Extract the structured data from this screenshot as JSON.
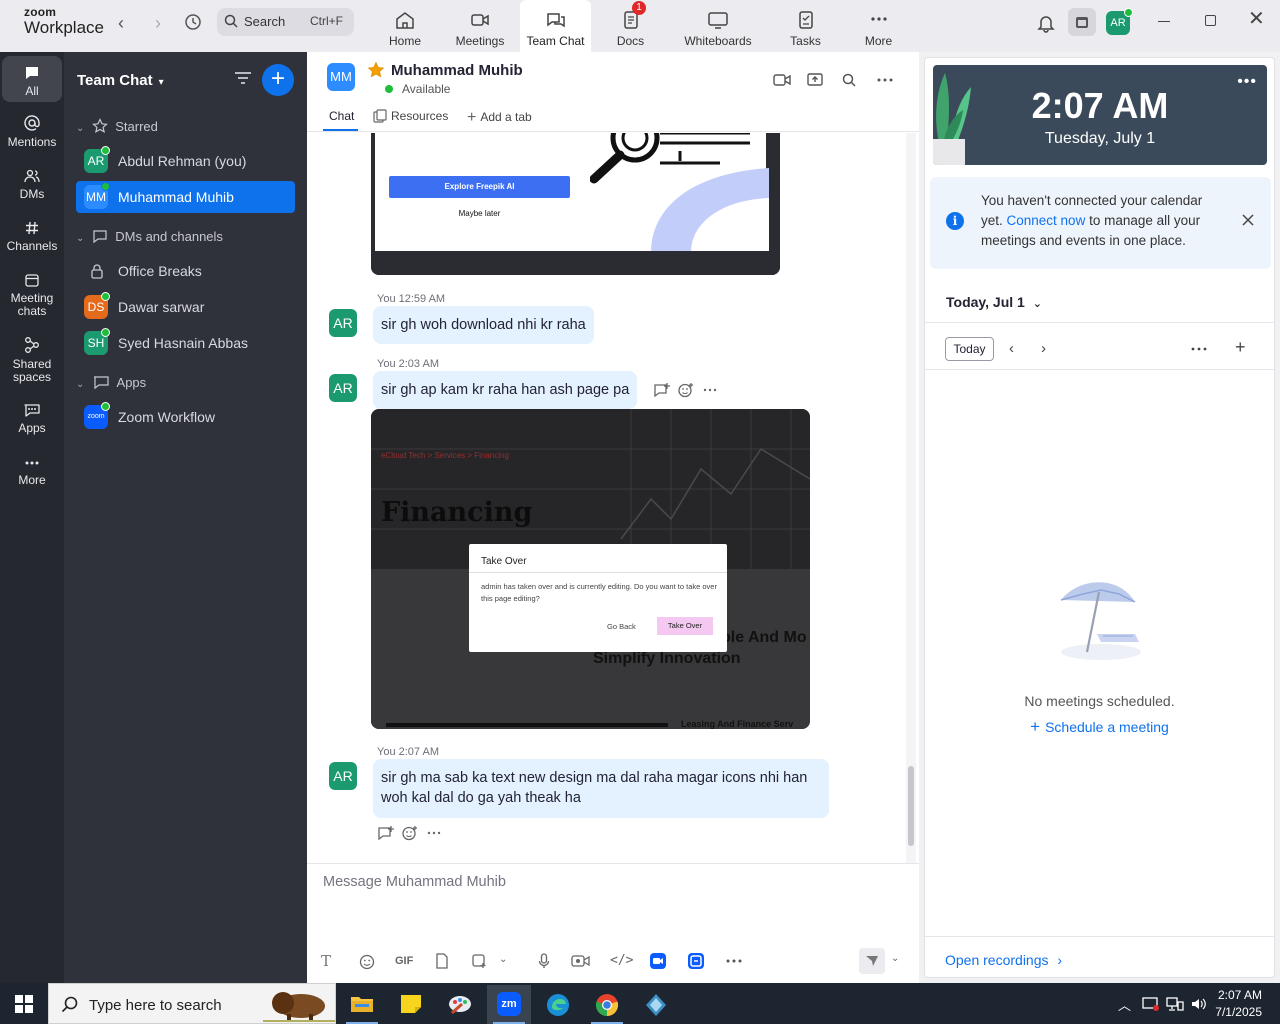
{
  "app": {
    "brand_line1": "zoom",
    "brand_line2": "Workplace"
  },
  "search": {
    "label": "Search",
    "shortcut": "Ctrl+F"
  },
  "top_tabs": [
    {
      "label": "Home",
      "icon": "home-icon"
    },
    {
      "label": "Meetings",
      "icon": "video-icon"
    },
    {
      "label": "Team Chat",
      "icon": "chat-icon",
      "active": true
    },
    {
      "label": "Docs",
      "icon": "docs-icon",
      "badge": "1"
    },
    {
      "label": "Whiteboards",
      "icon": "whiteboard-icon"
    },
    {
      "label": "Tasks",
      "icon": "tasks-icon"
    },
    {
      "label": "More",
      "icon": "more-dots-icon"
    }
  ],
  "user_avatar": "AR",
  "rail": [
    {
      "label": "All",
      "icon": "chat-bubble-icon",
      "active": true
    },
    {
      "label": "Mentions",
      "icon": "at-icon"
    },
    {
      "label": "DMs",
      "icon": "people-icon"
    },
    {
      "label": "Channels",
      "icon": "hash-icon"
    },
    {
      "label": "Meeting chats",
      "icon": "calendar-icon"
    },
    {
      "label": "Shared spaces",
      "icon": "shared-spaces-icon"
    },
    {
      "label": "Apps",
      "icon": "apps-icon"
    },
    {
      "label": "More",
      "icon": "more-dots-icon"
    }
  ],
  "list": {
    "title": "Team Chat",
    "sections": {
      "starred": "Starred",
      "dms": "DMs and channels",
      "apps": "Apps"
    },
    "starred_items": [
      {
        "initials": "AR",
        "name": "Abdul Rehman (you)",
        "color": "#1a9a6e"
      },
      {
        "initials": "MM",
        "name": "Muhammad Muhib",
        "color": "#2d8cff",
        "active": true
      }
    ],
    "dm_items": [
      {
        "initials": "",
        "name": "Office Breaks",
        "color": ""
      },
      {
        "initials": "DS",
        "name": "Dawar sarwar",
        "color": "#e46a1c"
      },
      {
        "initials": "SH",
        "name": "Syed Hasnain Abbas",
        "color": "#1a9a6e"
      }
    ],
    "app_items": [
      {
        "initials": "zoom",
        "name": "Zoom Workflow",
        "color": "#0b5cff"
      }
    ]
  },
  "chat": {
    "initials": "MM",
    "name": "Muhammad Muhib",
    "status": "Available",
    "tabs": [
      "Chat",
      "Resources",
      "Add a tab"
    ],
    "messages": [
      {
        "meta": "You 12:59 AM",
        "text": "sir gh woh download nhi kr raha"
      },
      {
        "meta": "You 2:03 AM",
        "text": "sir gh ap kam kr raha han ash page pa"
      },
      {
        "meta": "You 2:07 AM",
        "text_line1": "sir gh ma sab ka text new design ma dal raha magar icons nhi han",
        "text_line2": "woh kal dal do ga yah theak ha"
      }
    ],
    "avatar": "AR",
    "img1": {
      "button": "Explore Freepik AI",
      "secondary": "Maybe later"
    },
    "img2": {
      "breadcrumb": "eCloud Tech  >  Services  >  Financing",
      "heading": "Financing",
      "dialog_title": "Take Over",
      "dialog_body": "admin has taken over and is currently editing. Do you want to take over this page editing?",
      "dialog_back": "Go Back",
      "dialog_confirm": "Take Over",
      "bg_line1": "ble And Mo",
      "bg_line2": "Simplify Innovation",
      "bg_footer": "Leasing And Finance Serv"
    },
    "composer_placeholder": "Message Muhammad Muhib",
    "gif_label": "GIF"
  },
  "right": {
    "time": "2:07 AM",
    "date": "Tuesday, July 1",
    "note_pre": "You haven't connected your calendar yet. ",
    "note_link": "Connect now",
    "note_post": " to manage all your meetings and events in one place.",
    "today_header": "Today, Jul 1",
    "today_btn": "Today",
    "no_meetings": "No meetings scheduled.",
    "schedule": "Schedule a meeting",
    "open_recordings": "Open recordings"
  },
  "taskbar": {
    "search": "Type here to search",
    "time": "2:07 AM",
    "date": "7/1/2025"
  },
  "colors": {
    "accent": "#0e72ed",
    "sidebar": "#2f323a",
    "rail": "#25282f",
    "bubble": "#e4f1fe",
    "online": "#1fbe3a"
  }
}
